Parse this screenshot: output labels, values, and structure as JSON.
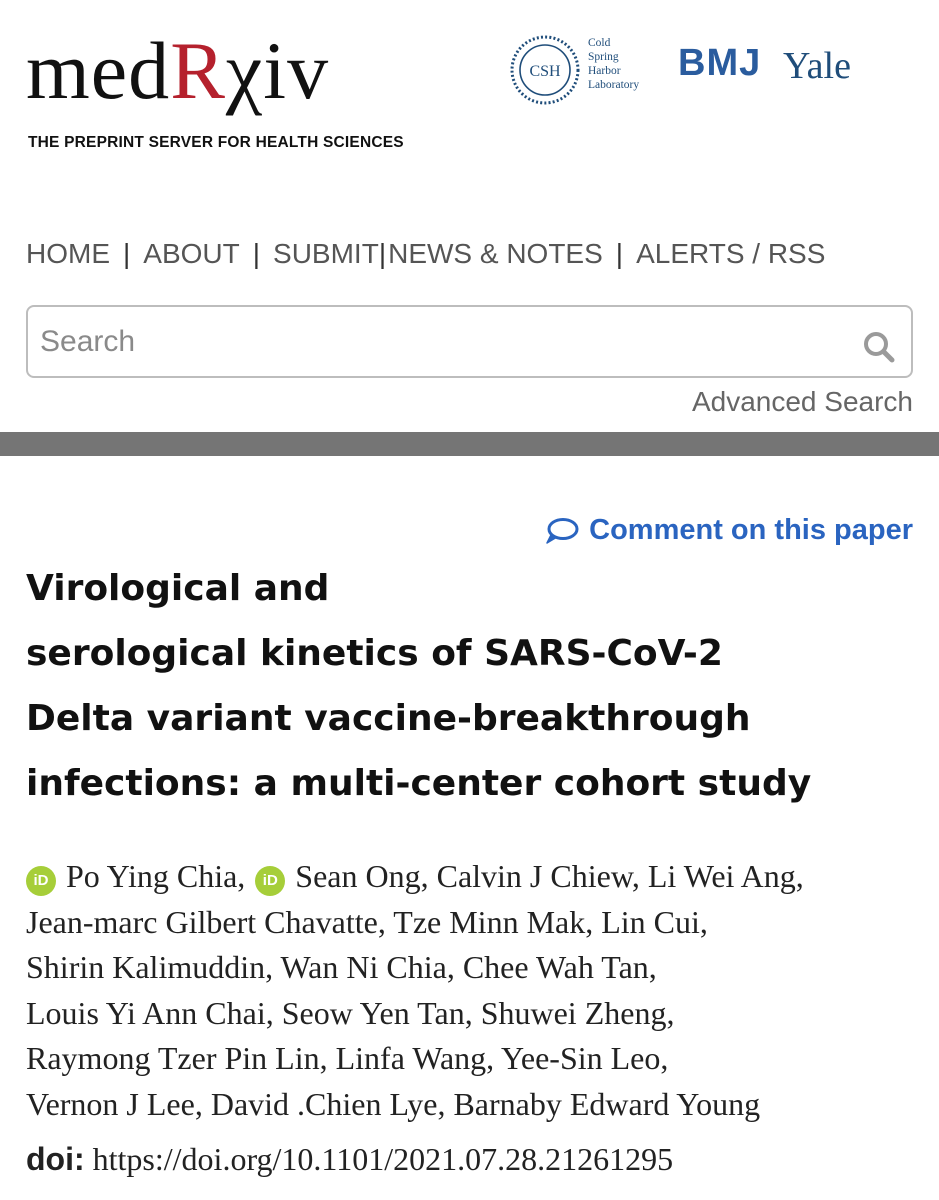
{
  "header": {
    "logo": {
      "part_med": "med",
      "part_r": "R",
      "part_iv": "χiv"
    },
    "tagline": "THE PREPRINT SERVER FOR HEALTH SCIENCES",
    "partners": {
      "csh_seal_text": "CSH",
      "csh_lines": [
        "Cold",
        "Spring",
        "Harbor",
        "Laboratory"
      ],
      "bmj": "BMJ",
      "yale": "Yale"
    }
  },
  "nav": {
    "items": [
      "HOME",
      "ABOUT",
      "SUBMIT",
      "NEWS & NOTES",
      "ALERTS / RSS"
    ],
    "separator": "|"
  },
  "search": {
    "placeholder": "Search",
    "advanced_label": "Advanced Search"
  },
  "paper": {
    "comment_label": "Comment on this paper",
    "title_lines": [
      "Virological and",
      "serological kinetics of SARS-CoV-2",
      "Delta variant vaccine-breakthrough",
      "infections: a multi-center cohort study"
    ],
    "orcid_badge": "iD",
    "author_lines": [
      "Po Ying Chia,",
      "Sean Ong, Calvin J Chiew, Li Wei Ang,",
      "Jean-marc Gilbert Chavatte, Tze Minn Mak, Lin Cui,",
      "Shirin Kalimuddin, Wan Ni Chia, Chee Wah Tan,",
      "Louis Yi Ann Chai, Seow Yen Tan, Shuwei Zheng,",
      "Raymong Tzer Pin Lin, Linfa Wang, Yee-Sin Leo,",
      "Vernon J Lee, David .Chien Lye, Barnaby Edward Young"
    ],
    "doi_label": "doi:",
    "doi_url": "https://doi.org/10.1101/2021.07.28.21261295"
  },
  "colors": {
    "logo_accent": "#b5212d",
    "link_blue": "#2a64c0",
    "orcid_green": "#a6ce39",
    "divider_gray": "#757575"
  },
  "icons": [
    "csh-seal-icon",
    "search-icon",
    "comment-bubble-icon",
    "orcid-icon"
  ]
}
